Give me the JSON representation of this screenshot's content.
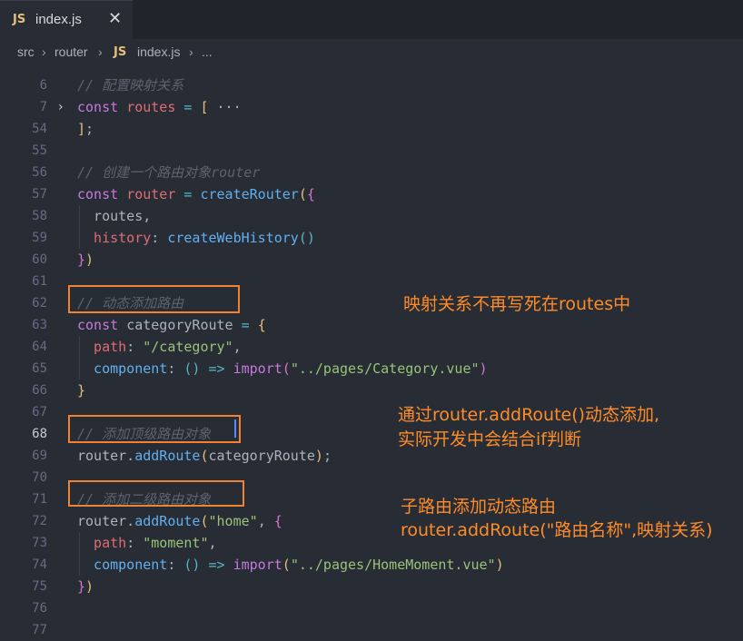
{
  "tab": {
    "lang_badge": "JS",
    "file_name": "index.js",
    "close_glyph": "✕"
  },
  "breadcrumb": {
    "folder1": "src",
    "folder2": "router",
    "lang_badge": "JS",
    "file": "index.js",
    "more": "...",
    "sep": "›"
  },
  "code_lines": [
    {
      "num": "6",
      "tokens": [
        [
          "t-cm",
          "// 配置映射关系"
        ]
      ]
    },
    {
      "num": "7",
      "fold": "›",
      "tokens": [
        [
          "t-kw",
          "const "
        ],
        [
          "t-var",
          "routes"
        ],
        [
          "t-op",
          " = "
        ],
        [
          "t-br",
          "["
        ],
        [
          "t-pl",
          " ···"
        ]
      ]
    },
    {
      "num": "54",
      "tokens": [
        [
          "t-br",
          "]"
        ],
        [
          "t-pl",
          ";"
        ]
      ]
    },
    {
      "num": "55",
      "tokens": []
    },
    {
      "num": "56",
      "tokens": [
        [
          "t-cm",
          "// 创建一个路由对象router"
        ]
      ]
    },
    {
      "num": "57",
      "tokens": [
        [
          "t-kw",
          "const "
        ],
        [
          "t-var",
          "router"
        ],
        [
          "t-op",
          " = "
        ],
        [
          "t-fn",
          "createRouter"
        ],
        [
          "t-br",
          "("
        ],
        [
          "t-br2",
          "{"
        ]
      ]
    },
    {
      "num": "58",
      "tokens": [
        [
          "t-pl",
          "  routes,"
        ]
      ]
    },
    {
      "num": "59",
      "tokens": [
        [
          "t-var",
          "  history"
        ],
        [
          "t-pl",
          ": "
        ],
        [
          "t-fn",
          "createWebHistory"
        ],
        [
          "t-op",
          "()"
        ]
      ]
    },
    {
      "num": "60",
      "tokens": [
        [
          "t-br2",
          "}"
        ],
        [
          "t-br",
          ")"
        ]
      ]
    },
    {
      "num": "61",
      "tokens": []
    },
    {
      "num": "62",
      "tokens": [
        [
          "t-cm",
          "// 动态添加路由"
        ]
      ]
    },
    {
      "num": "63",
      "tokens": [
        [
          "t-kw",
          "const "
        ],
        [
          "t-pl",
          "categoryRoute"
        ],
        [
          "t-op",
          " = "
        ],
        [
          "t-br",
          "{"
        ]
      ]
    },
    {
      "num": "64",
      "tokens": [
        [
          "t-var",
          "  path"
        ],
        [
          "t-pl",
          ": "
        ],
        [
          "t-str",
          "\"/category\""
        ],
        [
          "t-pl",
          ","
        ]
      ]
    },
    {
      "num": "65",
      "tokens": [
        [
          "t-fn",
          "  component"
        ],
        [
          "t-pl",
          ": "
        ],
        [
          "t-op",
          "() => "
        ],
        [
          "t-kw",
          "import"
        ],
        [
          "t-br2",
          "("
        ],
        [
          "t-str",
          "\"../pages/Category.vue\""
        ],
        [
          "t-br2",
          ")"
        ]
      ]
    },
    {
      "num": "66",
      "tokens": [
        [
          "t-br",
          "}"
        ]
      ]
    },
    {
      "num": "67",
      "tokens": []
    },
    {
      "num": "68",
      "active": true,
      "tokens": [
        [
          "t-cm",
          "// 添加顶级路由对象"
        ]
      ]
    },
    {
      "num": "69",
      "tokens": [
        [
          "t-pl",
          "router."
        ],
        [
          "t-fn",
          "addRoute"
        ],
        [
          "t-br",
          "("
        ],
        [
          "t-pl",
          "categoryRoute"
        ],
        [
          "t-br",
          ")"
        ],
        [
          "t-pl",
          ";"
        ]
      ]
    },
    {
      "num": "70",
      "tokens": []
    },
    {
      "num": "71",
      "tokens": [
        [
          "t-cm",
          "// 添加二级路由对象"
        ]
      ]
    },
    {
      "num": "72",
      "tokens": [
        [
          "t-pl",
          "router."
        ],
        [
          "t-fn",
          "addRoute"
        ],
        [
          "t-br",
          "("
        ],
        [
          "t-str",
          "\"home\""
        ],
        [
          "t-pl",
          ", "
        ],
        [
          "t-br2",
          "{"
        ]
      ]
    },
    {
      "num": "73",
      "tokens": [
        [
          "t-var",
          "  path"
        ],
        [
          "t-pl",
          ": "
        ],
        [
          "t-str",
          "\"moment\""
        ],
        [
          "t-pl",
          ","
        ]
      ]
    },
    {
      "num": "74",
      "tokens": [
        [
          "t-fn",
          "  component"
        ],
        [
          "t-pl",
          ": "
        ],
        [
          "t-op",
          "() => "
        ],
        [
          "t-kw",
          "import"
        ],
        [
          "t-br",
          "("
        ],
        [
          "t-str",
          "\"../pages/HomeMoment.vue\""
        ],
        [
          "t-br",
          ")"
        ]
      ]
    },
    {
      "num": "75",
      "tokens": [
        [
          "t-br2",
          "}"
        ],
        [
          "t-br",
          ")"
        ]
      ]
    },
    {
      "num": "76",
      "tokens": []
    },
    {
      "num": "77",
      "tokens": []
    }
  ],
  "annotations": {
    "note1": "映射关系不再写死在routes中",
    "note2_line1": "通过router.addRoute()动态添加,",
    "note2_line2": "实际开发中会结合if判断",
    "note3_line1": "子路由添加动态路由",
    "note3_line2": "router.addRoute(\"路由名称\",映射关系)"
  },
  "colors": {
    "accent_box": "#f08232",
    "note_text": "#ff8c28",
    "editor_bg": "#282c34"
  }
}
